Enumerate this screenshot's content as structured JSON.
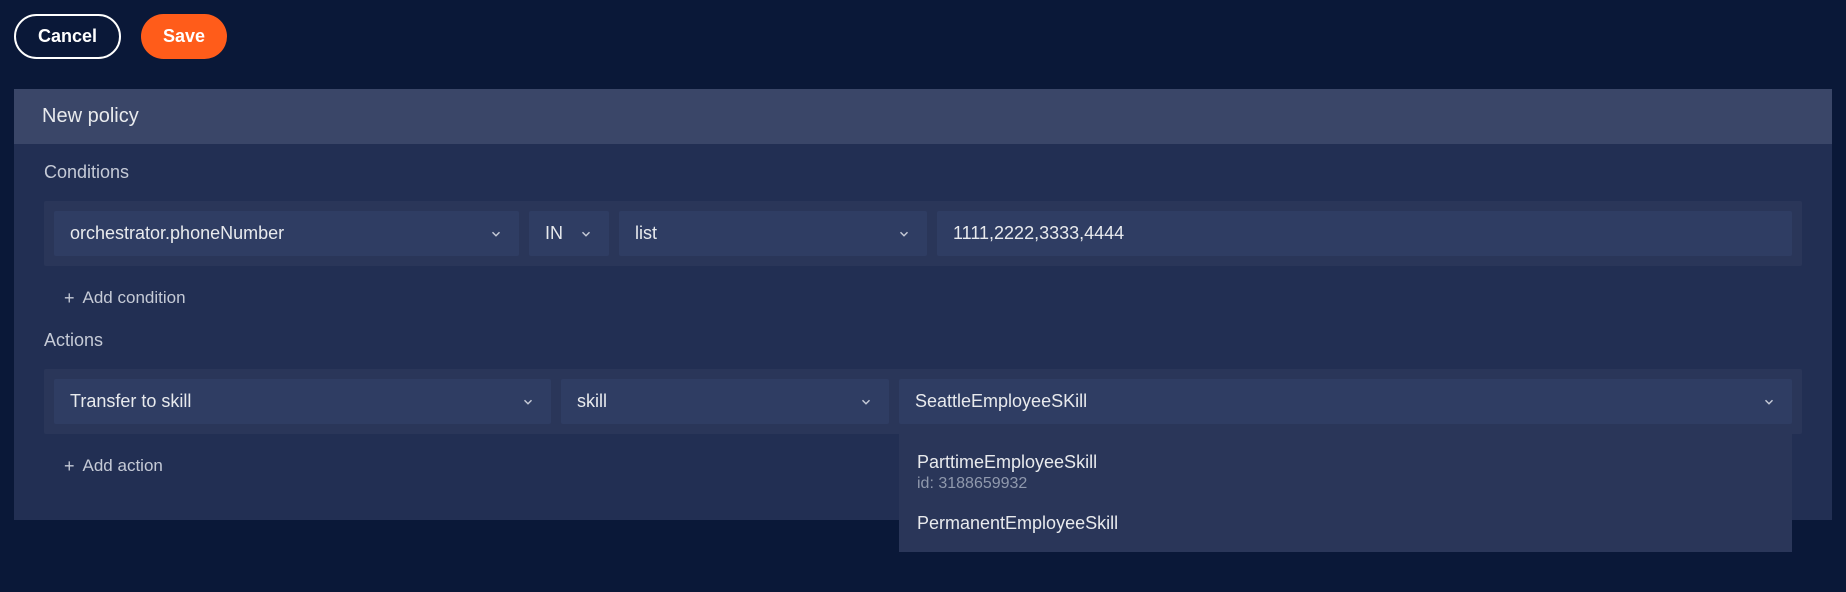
{
  "toolbar": {
    "cancel_label": "Cancel",
    "save_label": "Save"
  },
  "panel": {
    "title": "New policy"
  },
  "conditions": {
    "label": "Conditions",
    "items": [
      {
        "attribute": "orchestrator.phoneNumber",
        "operator": "IN",
        "type": "list",
        "value": "1111,2222,3333,4444"
      }
    ],
    "add_label": "Add condition"
  },
  "actions": {
    "label": "Actions",
    "items": [
      {
        "action": "Transfer to skill",
        "param": "skill",
        "value": "SeattleEmployeeSKill"
      }
    ],
    "add_label": "Add action",
    "dropdown": [
      {
        "name": "ParttimeEmployeeSkill",
        "id": "id: 3188659932"
      },
      {
        "name": "PermanentEmployeeSkill",
        "id": ""
      }
    ]
  }
}
